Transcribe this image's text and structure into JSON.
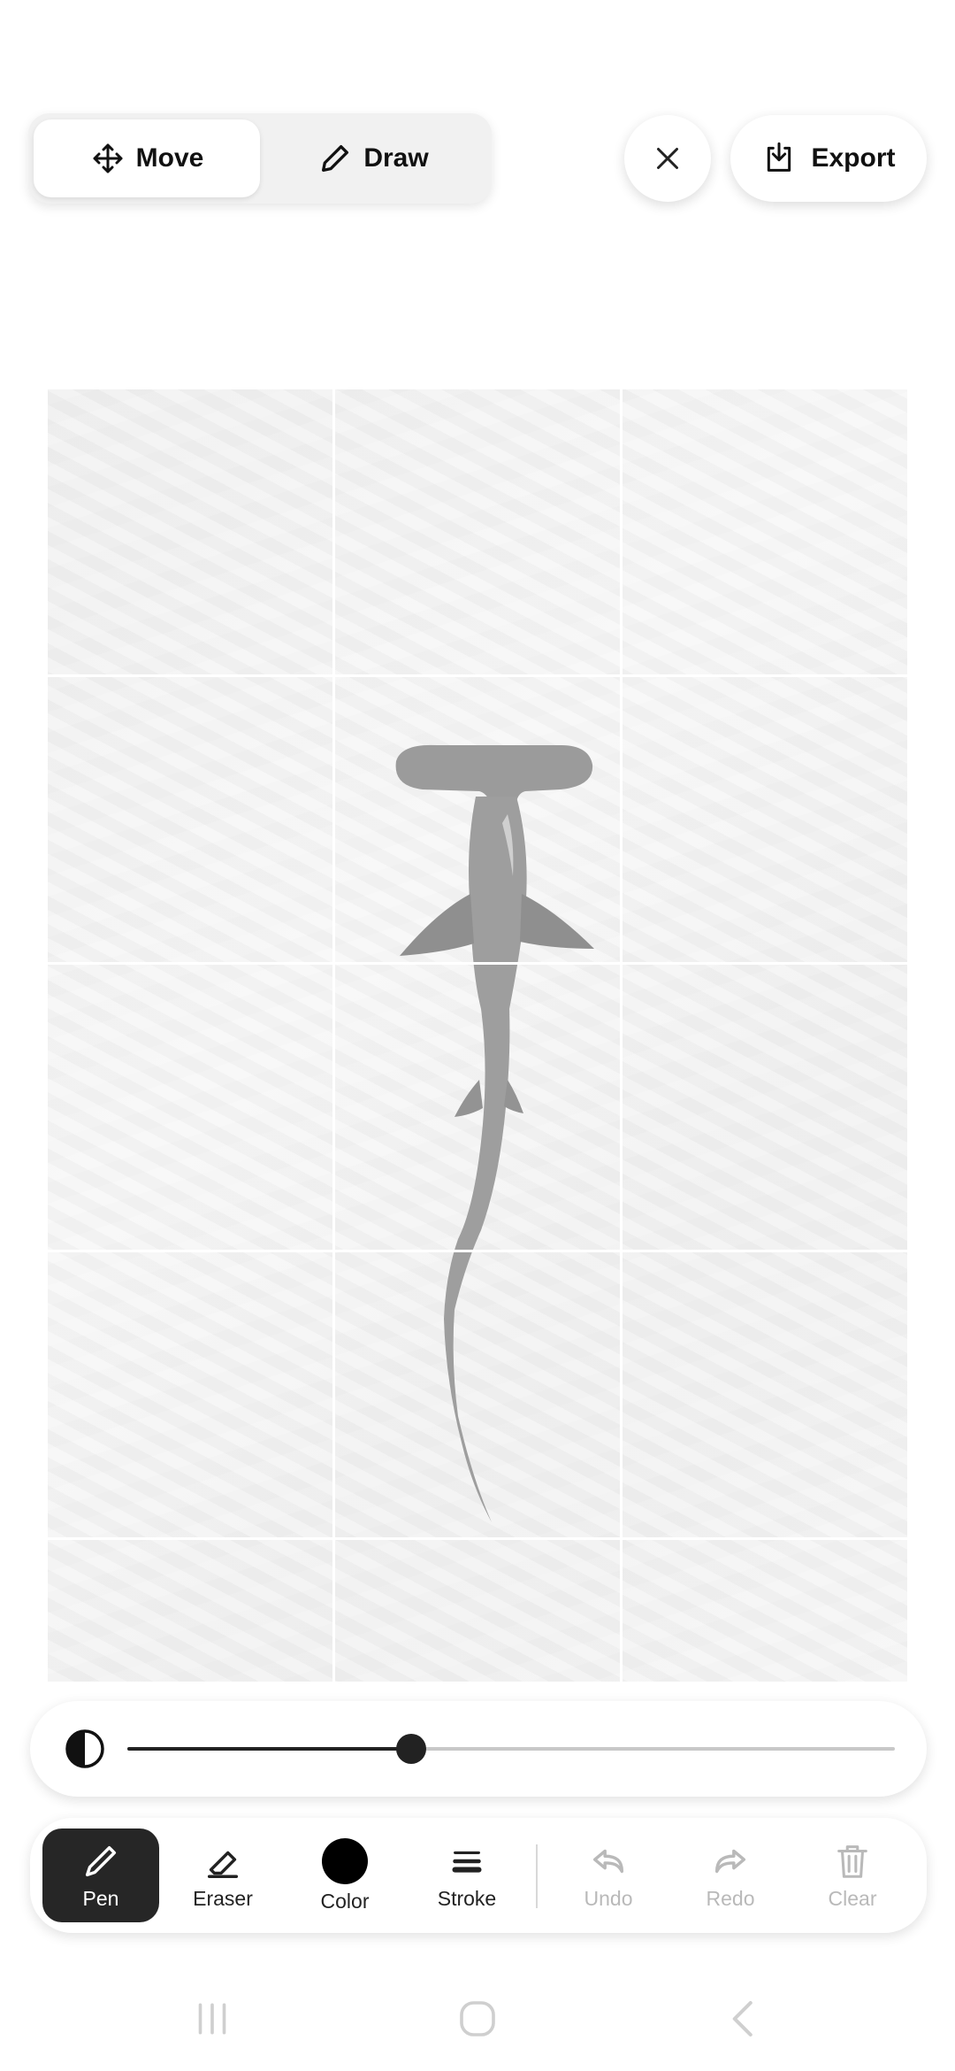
{
  "toolbar": {
    "move_label": "Move",
    "draw_label": "Draw",
    "export_label": "Export",
    "active_mode": "Move"
  },
  "canvas": {
    "grid": "3x5",
    "subject": "hammerhead-shark-image"
  },
  "opacity_slider": {
    "value": 0.37
  },
  "tools": {
    "pen_label": "Pen",
    "eraser_label": "Eraser",
    "color_label": "Color",
    "stroke_label": "Stroke",
    "undo_label": "Undo",
    "redo_label": "Redo",
    "clear_label": "Clear",
    "selected_color": "#000000",
    "active_tool": "Pen"
  },
  "icons": {
    "move": "move-arrows-icon",
    "draw": "pencil-icon",
    "close": "close-icon",
    "export": "download-icon",
    "opacity": "contrast-icon",
    "pen": "pencil-icon",
    "eraser": "eraser-icon",
    "stroke": "stroke-lines-icon",
    "undo": "undo-arrow-icon",
    "redo": "redo-arrow-icon",
    "clear": "trash-icon"
  }
}
